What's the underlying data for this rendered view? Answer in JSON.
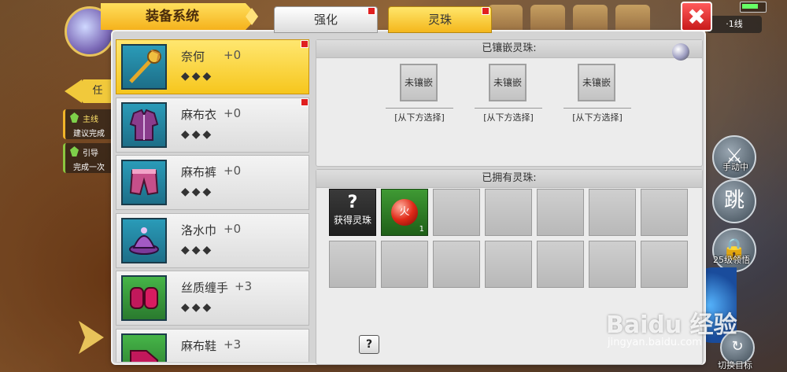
{
  "hud": {
    "tab_label": "任",
    "quests": [
      {
        "tag": "主线",
        "desc": "建议完成"
      },
      {
        "tag": "引导",
        "desc": "完成一次"
      }
    ]
  },
  "server": {
    "label": "·1线"
  },
  "right_controls": {
    "manual_label": "手动中",
    "jump_glyph": "跳",
    "lock_label": "25级领悟",
    "switch_label": "切换目标"
  },
  "panel": {
    "title": "装备系统",
    "tabs": [
      {
        "label": "强化"
      },
      {
        "label": "灵珠"
      }
    ],
    "close_glyph": "✖"
  },
  "equipment": [
    {
      "name": "奈何",
      "level": "+0",
      "stars": "◆◆◆"
    },
    {
      "name": "麻布衣",
      "level": "+0",
      "stars": "◆◆◆"
    },
    {
      "name": "麻布裤",
      "level": "+0",
      "stars": "◆◆◆"
    },
    {
      "name": "洛水巾",
      "level": "+0",
      "stars": "◆◆◆"
    },
    {
      "name": "丝质缠手",
      "level": "+3",
      "stars": "◆◆◆"
    },
    {
      "name": "麻布鞋",
      "level": "+3",
      "stars": ""
    }
  ],
  "inlaid": {
    "header": "已镶嵌灵珠:",
    "slots": [
      {
        "label": "未镶嵌",
        "hint": "[从下方选择]"
      },
      {
        "label": "未镶嵌",
        "hint": "[从下方选择]"
      },
      {
        "label": "未镶嵌",
        "hint": "[从下方选择]"
      }
    ]
  },
  "owned": {
    "header": "已拥有灵珠:",
    "get_glyph": "?",
    "get_label": "获得灵珠",
    "fire_orb": {
      "glyph": "火",
      "count": "1"
    }
  },
  "help_glyph": "?",
  "watermark": {
    "text": "Baidu 经验",
    "url": "jingyan.baidu.com"
  },
  "colors": {
    "accent": "#f6c61d",
    "close": "#d92424",
    "panel": "#d4d4d4"
  }
}
